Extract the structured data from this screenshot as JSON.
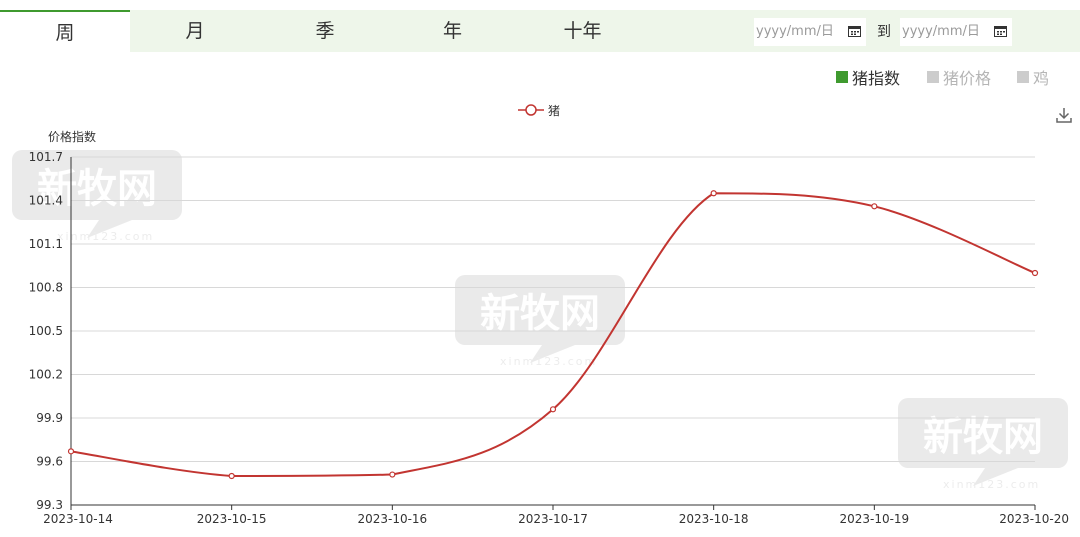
{
  "tabs": [
    {
      "label": "周",
      "active": true
    },
    {
      "label": "月",
      "active": false
    },
    {
      "label": "季",
      "active": false
    },
    {
      "label": "年",
      "active": false
    },
    {
      "label": "十年",
      "active": false
    }
  ],
  "date_range": {
    "start_placeholder": "yyyy/mm/日",
    "to_label": "到",
    "end_placeholder": "yyyy/mm/日"
  },
  "index_toggles": [
    {
      "label": "猪指数",
      "active": true,
      "color": "#3f9a2f"
    },
    {
      "label": "猪价格",
      "active": false,
      "color": "#cccccc"
    },
    {
      "label": "鸡",
      "active": false,
      "color": "#cccccc"
    }
  ],
  "watermark": {
    "brand": "新牧网",
    "url": "xinm123.com"
  },
  "colors": {
    "series": "#c23531",
    "tab_active_border": "#3f9a2f",
    "tabbar_bg": "#eef6ea"
  },
  "icons": {
    "calendar": "calendar-icon",
    "download": "download-icon"
  },
  "chart_data": {
    "type": "line",
    "ylabel": "价格指数",
    "xlabel": "",
    "ylim": [
      99.3,
      101.7
    ],
    "yticks": [
      99.3,
      99.6,
      99.9,
      100.2,
      100.5,
      100.8,
      101.1,
      101.4,
      101.7
    ],
    "categories": [
      "2023-10-14",
      "2023-10-15",
      "2023-10-16",
      "2023-10-17",
      "2023-10-18",
      "2023-10-19",
      "2023-10-20"
    ],
    "series": [
      {
        "name": "猪",
        "values": [
          99.67,
          99.5,
          99.51,
          99.96,
          101.45,
          101.36,
          100.9
        ]
      }
    ],
    "smooth": true,
    "grid": "horizontal",
    "legend_position": "top-center"
  }
}
